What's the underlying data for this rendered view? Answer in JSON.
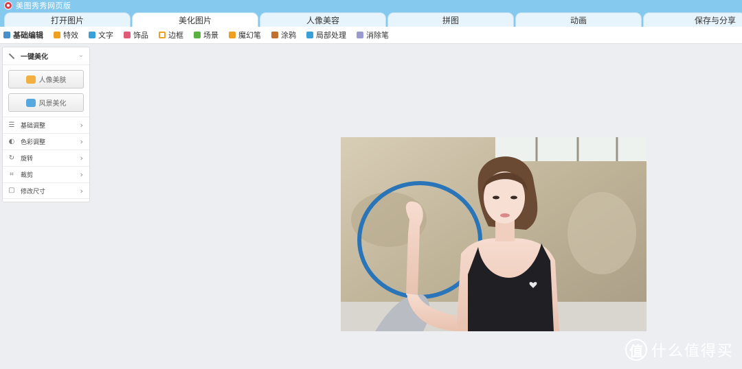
{
  "app": {
    "title": "美图秀秀网页版"
  },
  "tabs": [
    {
      "label": "打开图片",
      "active": false
    },
    {
      "label": "美化图片",
      "active": true
    },
    {
      "label": "人像美容",
      "active": false
    },
    {
      "label": "拼图",
      "active": false
    },
    {
      "label": "动画",
      "active": false
    },
    {
      "label": "保存与分享",
      "active": false
    }
  ],
  "toolbar": {
    "items": [
      {
        "label": "基础编辑",
        "icon": "edit-icon",
        "color": "#4a90c8"
      },
      {
        "label": "特效",
        "icon": "effects-icon",
        "color": "#f0a020"
      },
      {
        "label": "文字",
        "icon": "text-icon",
        "color": "#3aa0d8"
      },
      {
        "label": "饰品",
        "icon": "accessory-icon",
        "color": "#e05a7a"
      },
      {
        "label": "边框",
        "icon": "frame-icon",
        "color": "#f0a020"
      },
      {
        "label": "场景",
        "icon": "scene-icon",
        "color": "#5ab040"
      },
      {
        "label": "魔幻笔",
        "icon": "magic-pen-icon",
        "color": "#f0a020"
      },
      {
        "label": "涂鸦",
        "icon": "doodle-icon",
        "color": "#c07030"
      },
      {
        "label": "局部处理",
        "icon": "local-edit-icon",
        "color": "#3aa0d8"
      },
      {
        "label": "消除笔",
        "icon": "eraser-icon",
        "color": "#9a9acf"
      }
    ]
  },
  "panel": {
    "header": "一键美化",
    "buttons": [
      {
        "label": "人像美肤",
        "icon": "portrait-icon",
        "color": "#f2b040"
      },
      {
        "label": "风景美化",
        "icon": "landscape-icon",
        "color": "#58a8e0"
      }
    ],
    "rows": [
      {
        "label": "基础调整",
        "icon": "sliders-icon",
        "glyph": "☰"
      },
      {
        "label": "色彩调整",
        "icon": "palette-icon",
        "glyph": "◐"
      },
      {
        "label": "旋转",
        "icon": "rotate-icon",
        "glyph": "↻"
      },
      {
        "label": "裁剪",
        "icon": "crop-icon",
        "glyph": "⌗"
      },
      {
        "label": "修改尺寸",
        "icon": "resize-icon",
        "glyph": "▢"
      }
    ],
    "arrow": "›",
    "collapse_glyph": "⌄"
  },
  "watermark": {
    "glyph": "值",
    "text": "什么值得买"
  },
  "colors": {
    "titlebar": "#86c9ee",
    "tab_inactive": "#e7f4fc",
    "tab_active": "#ffffff",
    "canvas": "#eceef1"
  }
}
